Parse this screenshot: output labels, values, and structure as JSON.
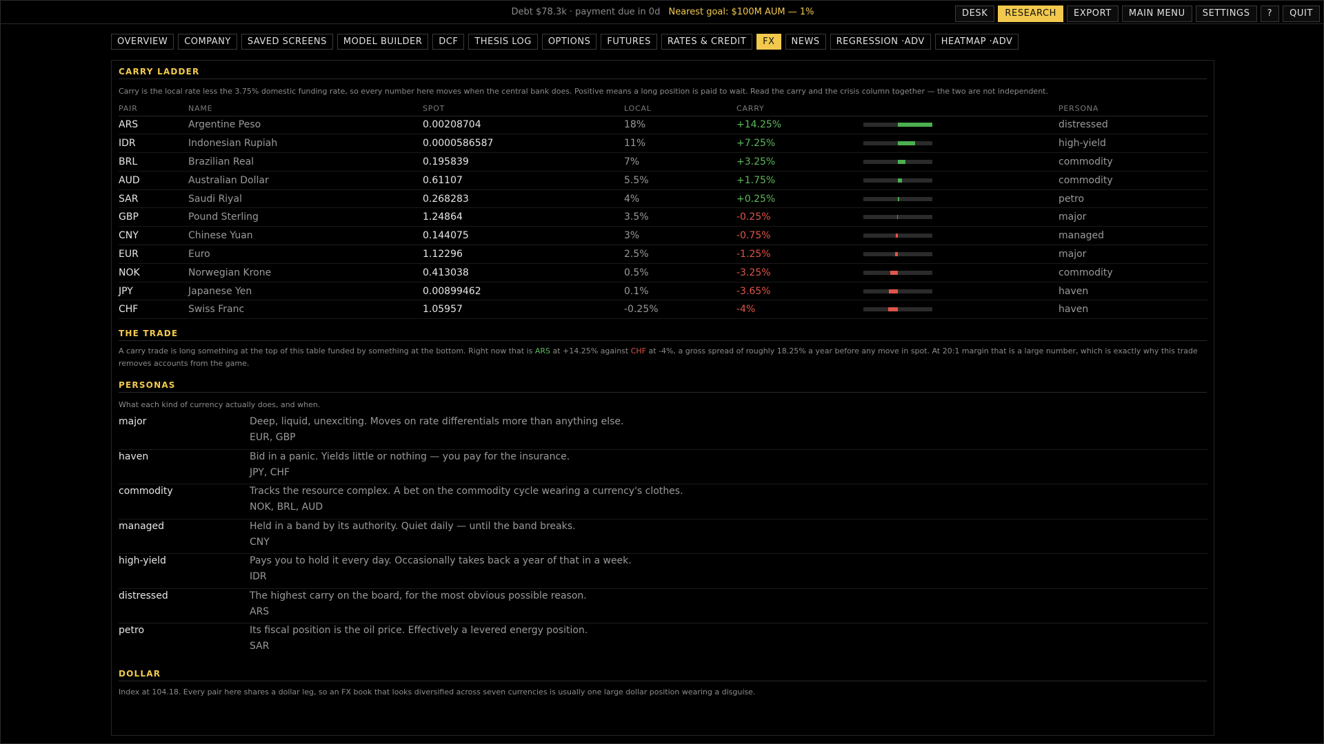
{
  "status": {
    "debt": "Debt $78.3k · payment due in 0d",
    "goal": "Nearest goal: $100M AUM — 1%"
  },
  "topnav": [
    "DESK",
    "RESEARCH",
    "EXPORT",
    "MAIN MENU",
    "SETTINGS",
    "?",
    "QUIT"
  ],
  "topnav_active": "RESEARCH",
  "tabs": [
    "OVERVIEW",
    "COMPANY",
    "SAVED SCREENS",
    "MODEL BUILDER",
    "DCF",
    "THESIS LOG",
    "OPTIONS",
    "FUTURES",
    "RATES & CREDIT",
    "FX",
    "NEWS",
    "REGRESSION ·ADV",
    "HEATMAP ·ADV"
  ],
  "tab_active": "FX",
  "carry": {
    "title": "CARRY LADDER",
    "description": "Carry is the local rate less the 3.75% domestic funding rate, so every number here moves when the central bank does. Positive means a long position is paid to wait. Read the carry and the crisis column together — the two are not independent.",
    "columns": {
      "pair": "PAIR",
      "name": "NAME",
      "spot": "SPOT",
      "local": "LOCAL",
      "carry": "CARRY",
      "persona": "PERSONA"
    },
    "scale_max_abs": 14.25,
    "rows": [
      {
        "pair": "ARS",
        "name": "Argentine Peso",
        "spot": "0.00208704",
        "local": "18%",
        "carry": "+14.25%",
        "carry_value": 14.25,
        "persona": "distressed"
      },
      {
        "pair": "IDR",
        "name": "Indonesian Rupiah",
        "spot": "0.0000586587",
        "local": "11%",
        "carry": "+7.25%",
        "carry_value": 7.25,
        "persona": "high-yield"
      },
      {
        "pair": "BRL",
        "name": "Brazilian Real",
        "spot": "0.195839",
        "local": "7%",
        "carry": "+3.25%",
        "carry_value": 3.25,
        "persona": "commodity"
      },
      {
        "pair": "AUD",
        "name": "Australian Dollar",
        "spot": "0.61107",
        "local": "5.5%",
        "carry": "+1.75%",
        "carry_value": 1.75,
        "persona": "commodity"
      },
      {
        "pair": "SAR",
        "name": "Saudi Riyal",
        "spot": "0.268283",
        "local": "4%",
        "carry": "+0.25%",
        "carry_value": 0.25,
        "persona": "petro"
      },
      {
        "pair": "GBP",
        "name": "Pound Sterling",
        "spot": "1.24864",
        "local": "3.5%",
        "carry": "-0.25%",
        "carry_value": -0.25,
        "persona": "major"
      },
      {
        "pair": "CNY",
        "name": "Chinese Yuan",
        "spot": "0.144075",
        "local": "3%",
        "carry": "-0.75%",
        "carry_value": -0.75,
        "persona": "managed"
      },
      {
        "pair": "EUR",
        "name": "Euro",
        "spot": "1.12296",
        "local": "2.5%",
        "carry": "-1.25%",
        "carry_value": -1.25,
        "persona": "major"
      },
      {
        "pair": "NOK",
        "name": "Norwegian Krone",
        "spot": "0.413038",
        "local": "0.5%",
        "carry": "-3.25%",
        "carry_value": -3.25,
        "persona": "commodity"
      },
      {
        "pair": "JPY",
        "name": "Japanese Yen",
        "spot": "0.00899462",
        "local": "0.1%",
        "carry": "-3.65%",
        "carry_value": -3.65,
        "persona": "haven"
      },
      {
        "pair": "CHF",
        "name": "Swiss Franc",
        "spot": "1.05957",
        "local": "-0.25%",
        "carry": "-4%",
        "carry_value": -4,
        "persona": "haven"
      }
    ]
  },
  "trade": {
    "title": "THE TRADE",
    "text_1": "A carry trade is long something at the top of this table funded by something at the bottom. Right now that is ",
    "long_pair": "ARS",
    "text_2": " at +14.25% against ",
    "short_pair": "CHF",
    "text_3": " at -4%, a gross spread of roughly 18.25% a year before any move in spot. At 20:1 margin that is a large number, which is exactly why this trade removes accounts from the game."
  },
  "personas": {
    "title": "PERSONAS",
    "description": "What each kind of currency actually does, and when.",
    "items": [
      {
        "name": "major",
        "text": "Deep, liquid, unexciting. Moves on rate differentials more than anything else.",
        "currencies": "EUR, GBP"
      },
      {
        "name": "haven",
        "text": "Bid in a panic. Yields little or nothing — you pay for the insurance.",
        "currencies": "JPY, CHF"
      },
      {
        "name": "commodity",
        "text": "Tracks the resource complex. A bet on the commodity cycle wearing a currency's clothes.",
        "currencies": "NOK, BRL, AUD"
      },
      {
        "name": "managed",
        "text": "Held in a band by its authority. Quiet daily — until the band breaks.",
        "currencies": "CNY"
      },
      {
        "name": "high-yield",
        "text": "Pays you to hold it every day. Occasionally takes back a year of that in a week.",
        "currencies": "IDR"
      },
      {
        "name": "distressed",
        "text": "The highest carry on the board, for the most obvious possible reason.",
        "currencies": "ARS"
      },
      {
        "name": "petro",
        "text": "Its fiscal position is the oil price. Effectively a levered energy position.",
        "currencies": "SAR"
      }
    ]
  },
  "dollar": {
    "title": "DOLLAR",
    "text": "Index at 104.18. Every pair here shares a dollar leg, so an FX book that looks diversified across seven currencies is usually one large dollar position wearing a disguise."
  },
  "colors": {
    "accent": "#f2c94c",
    "positive": "#5cb85c",
    "negative": "#e0554a",
    "background": "#000000"
  }
}
